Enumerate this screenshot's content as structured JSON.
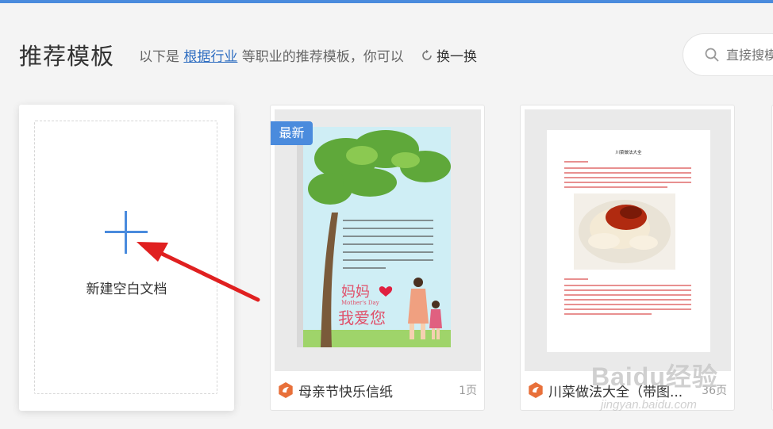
{
  "header": {
    "title": "推荐模板",
    "subtitle_prefix": "以下是 ",
    "subtitle_link": "根据行业",
    "subtitle_suffix": " 等职业的推荐模板，你可以",
    "refresh_label": "换一换"
  },
  "search": {
    "placeholder": "直接搜模板"
  },
  "blank_card": {
    "label": "新建空白文档"
  },
  "templates": [
    {
      "badge": "最新",
      "title": "母亲节快乐信纸",
      "pages": "1页"
    },
    {
      "title": "川菜做法大全（带图...",
      "pages": "36页"
    }
  ],
  "letter": {
    "title_cn": "妈妈",
    "title_en": "Mother's Day",
    "love": "我爱您"
  },
  "recipe_doc": {
    "heading": "川菜做法大全"
  },
  "watermark": {
    "main": "Baidu经验",
    "sub": "jingyan.baidu.com"
  },
  "colors": {
    "accent": "#4a8bdd",
    "link": "#2f6ec1",
    "arrow": "#e02020",
    "wps_orange": "#e8703a"
  }
}
